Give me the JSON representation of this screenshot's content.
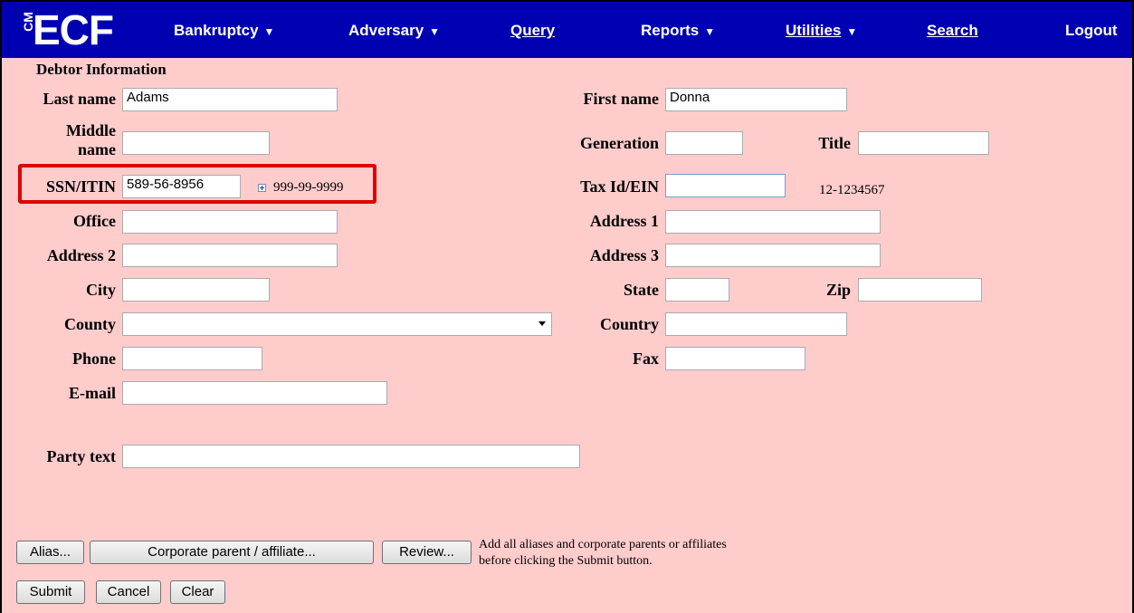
{
  "nav": {
    "logo_cm": "CM",
    "logo_ecf": "ECF",
    "items": [
      {
        "label": "Bankruptcy",
        "has_menu": true
      },
      {
        "label": "Adversary",
        "has_menu": true
      },
      {
        "label": "Query",
        "has_menu": false
      },
      {
        "label": "Reports",
        "has_menu": true
      },
      {
        "label": "Utilities",
        "has_menu": true
      },
      {
        "label": "Search",
        "has_menu": false
      },
      {
        "label": "Logout",
        "has_menu": false
      }
    ],
    "caret": "▼"
  },
  "form": {
    "section_title": "Debtor Information",
    "last_name": {
      "label": "Last name",
      "value": "Adams"
    },
    "first_name": {
      "label": "First name",
      "value": "Donna"
    },
    "middle_name": {
      "label_line1": "Middle",
      "label_line2": "name",
      "value": ""
    },
    "generation": {
      "label": "Generation",
      "value": ""
    },
    "title": {
      "label": "Title",
      "value": ""
    },
    "ssn": {
      "label": "SSN/ITIN",
      "value": "589-56-8956",
      "format_hint": "999-99-9999"
    },
    "tax_id": {
      "label": "Tax Id/EIN",
      "value": "",
      "format_hint": "12-1234567"
    },
    "office": {
      "label": "Office",
      "value": ""
    },
    "address1": {
      "label": "Address 1",
      "value": ""
    },
    "address2": {
      "label": "Address 2",
      "value": ""
    },
    "address3": {
      "label": "Address 3",
      "value": ""
    },
    "city": {
      "label": "City",
      "value": ""
    },
    "state": {
      "label": "State",
      "value": ""
    },
    "zip": {
      "label": "Zip",
      "value": ""
    },
    "county": {
      "label": "County",
      "value": ""
    },
    "country": {
      "label": "Country",
      "value": ""
    },
    "phone": {
      "label": "Phone",
      "value": ""
    },
    "fax": {
      "label": "Fax",
      "value": ""
    },
    "email": {
      "label": "E-mail",
      "value": ""
    },
    "party_text": {
      "label": "Party text",
      "value": ""
    }
  },
  "buttons": {
    "alias": "Alias...",
    "corporate": "Corporate parent / affiliate...",
    "review": "Review...",
    "submit": "Submit",
    "cancel": "Cancel",
    "clear": "Clear"
  },
  "note": {
    "line1": "Add all aliases and corporate parents or affiliates",
    "line2": "before clicking the Submit button."
  },
  "colors": {
    "nav_bg": "#0000b3",
    "form_bg": "#ffcccc",
    "highlight": "#e00000"
  }
}
